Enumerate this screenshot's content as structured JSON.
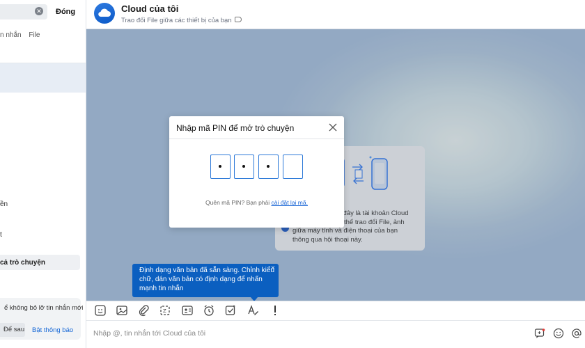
{
  "sidebar": {
    "close_label": "Đóng",
    "filters": [
      "n nhắn",
      "File"
    ],
    "item_a": "ền",
    "item_b": "t",
    "group_label": "cả trò chuyện",
    "notification": {
      "text": "ể không bỏ lỡ tin nhắn mới",
      "later_label": "Để sau",
      "enable_label": "Bật thông báo"
    }
  },
  "header": {
    "title": "Cloud của tôi",
    "subtitle": "Trao đổi File giữa các thiết bị của bạn"
  },
  "welcome": {
    "lines": [
      "n, đây là tài khoản Cloud",
      "thể trao đổi File, ảnh",
      "giữa máy tính và điện thoại của bạn",
      "thông qua hội thoại này."
    ]
  },
  "pin_modal": {
    "title": "Nhập mã PIN để mở trò chuyện",
    "digits": [
      "•",
      "•",
      "•",
      ""
    ],
    "help_prefix": "Quên mã PIN? Bạn phải ",
    "help_link": "cài đặt lại mã."
  },
  "tooltip": {
    "lines": [
      "Định dạng văn bản đã sẵn sàng. Chỉnh kiểu",
      "chữ, dán văn bản có định dạng để nhấn",
      "mạnh tin nhắn"
    ],
    "close": "×"
  },
  "composer": {
    "placeholder": "Nhập @, tin nhắn tới Cloud của tôi"
  },
  "colors": {
    "accent": "#0b5fc0",
    "pin_border": "#2b78d8"
  }
}
